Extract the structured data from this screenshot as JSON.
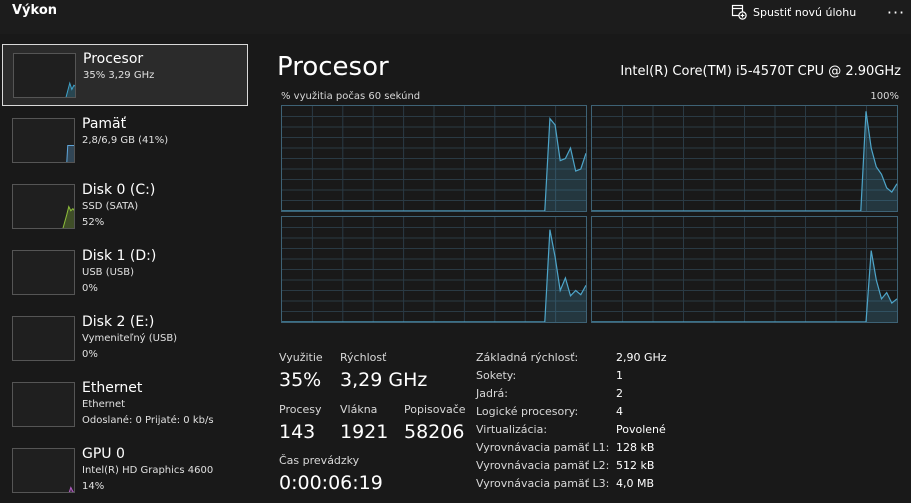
{
  "header": {
    "title": "Výkon",
    "run_task_label": "Spustiť novú úlohu",
    "more_label": "···"
  },
  "sidebar": {
    "items": [
      {
        "name": "Procesor",
        "sub1": "35% 3,29 GHz",
        "sub2": "",
        "sub3": "",
        "color": "#3fa1c8",
        "usage": 0.35
      },
      {
        "name": "Pamäť",
        "sub1": "2,8/6,9 GB (41%)",
        "sub2": "",
        "sub3": "",
        "color": "#5ea3d7",
        "usage": 0.41
      },
      {
        "name": "Disk 0 (C:)",
        "sub1": "SSD (SATA)",
        "sub2": "52%",
        "sub3": "",
        "color": "#8cbc3a",
        "usage": 0.52
      },
      {
        "name": "Disk 1 (D:)",
        "sub1": "USB (USB)",
        "sub2": "0%",
        "sub3": "",
        "color": "#8cbc3a",
        "usage": 0
      },
      {
        "name": "Disk 2 (E:)",
        "sub1": "Vymeniteľný (USB)",
        "sub2": "0%",
        "sub3": "",
        "color": "#8cbc3a",
        "usage": 0
      },
      {
        "name": "Ethernet",
        "sub1": "Ethernet",
        "sub2": "Odoslané: 0 Prijaté: 0 kb/s",
        "sub3": "",
        "color": "#c08a4a",
        "usage": 0
      },
      {
        "name": "GPU 0",
        "sub1": "Intel(R) HD Graphics 4600",
        "sub2": "14%",
        "sub3": "",
        "color": "#b25cc4",
        "usage": 0.14
      }
    ]
  },
  "main": {
    "title": "Procesor",
    "cpu_model": "Intel(R) Core(TM) i5-4570T CPU @ 2.90GHz",
    "graph_caption": "% využitia počas 60 sekúnd",
    "graph_max": "100%",
    "graph_color": "#4ea5c9"
  },
  "chart_data": {
    "type": "area",
    "title": "% využitia počas 60 sekúnd",
    "ylim": [
      0,
      100
    ],
    "grid": true,
    "series": [
      {
        "values": [
          0,
          0,
          0,
          0,
          0,
          0,
          0,
          0,
          0,
          0,
          0,
          0,
          0,
          0,
          0,
          0,
          0,
          0,
          0,
          0,
          0,
          0,
          0,
          0,
          0,
          0,
          0,
          0,
          0,
          0,
          0,
          0,
          0,
          0,
          0,
          0,
          0,
          0,
          0,
          0,
          0,
          0,
          0,
          0,
          0,
          0,
          0,
          0,
          0,
          0,
          0,
          0,
          88,
          82,
          48,
          50,
          60,
          38,
          40,
          55
        ]
      },
      {
        "values": [
          0,
          0,
          0,
          0,
          0,
          0,
          0,
          0,
          0,
          0,
          0,
          0,
          0,
          0,
          0,
          0,
          0,
          0,
          0,
          0,
          0,
          0,
          0,
          0,
          0,
          0,
          0,
          0,
          0,
          0,
          0,
          0,
          0,
          0,
          0,
          0,
          0,
          0,
          0,
          0,
          0,
          0,
          0,
          0,
          0,
          0,
          0,
          0,
          0,
          0,
          0,
          0,
          0,
          95,
          60,
          42,
          35,
          22,
          18,
          26
        ]
      },
      {
        "values": [
          0,
          0,
          0,
          0,
          0,
          0,
          0,
          0,
          0,
          0,
          0,
          0,
          0,
          0,
          0,
          0,
          0,
          0,
          0,
          0,
          0,
          0,
          0,
          0,
          0,
          0,
          0,
          0,
          0,
          0,
          0,
          0,
          0,
          0,
          0,
          0,
          0,
          0,
          0,
          0,
          0,
          0,
          0,
          0,
          0,
          0,
          0,
          0,
          0,
          0,
          0,
          0,
          88,
          62,
          30,
          42,
          25,
          30,
          26,
          35
        ]
      },
      {
        "values": [
          0,
          0,
          0,
          0,
          0,
          0,
          0,
          0,
          0,
          0,
          0,
          0,
          0,
          0,
          0,
          0,
          0,
          0,
          0,
          0,
          0,
          0,
          0,
          0,
          0,
          0,
          0,
          0,
          0,
          0,
          0,
          0,
          0,
          0,
          0,
          0,
          0,
          0,
          0,
          0,
          0,
          0,
          0,
          0,
          0,
          0,
          0,
          0,
          0,
          0,
          0,
          0,
          0,
          0,
          68,
          40,
          22,
          28,
          18,
          22
        ]
      }
    ]
  },
  "stats": {
    "utilization_label": "Využitie",
    "utilization_value": "35%",
    "speed_label": "Rýchlosť",
    "speed_value": "3,29 GHz",
    "processes_label": "Procesy",
    "processes_value": "143",
    "threads_label": "Vlákna",
    "threads_value": "1921",
    "handles_label": "Popisovače",
    "handles_value": "58206",
    "uptime_label": "Čas prevádzky",
    "uptime_value": "0:00:06:19"
  },
  "specs": [
    {
      "label": "Základná rýchlosť:",
      "value": "2,90 GHz"
    },
    {
      "label": "Sokety:",
      "value": "1"
    },
    {
      "label": "Jadrá:",
      "value": "2"
    },
    {
      "label": "Logické procesory:",
      "value": "4"
    },
    {
      "label": "Virtualizácia:",
      "value": "Povolené"
    },
    {
      "label": "Vyrovnávacia pamäť L1:",
      "value": "128 kB"
    },
    {
      "label": "Vyrovnávacia pamäť L2:",
      "value": "512 kB"
    },
    {
      "label": "Vyrovnávacia pamäť L3:",
      "value": "4,0 MB"
    }
  ]
}
